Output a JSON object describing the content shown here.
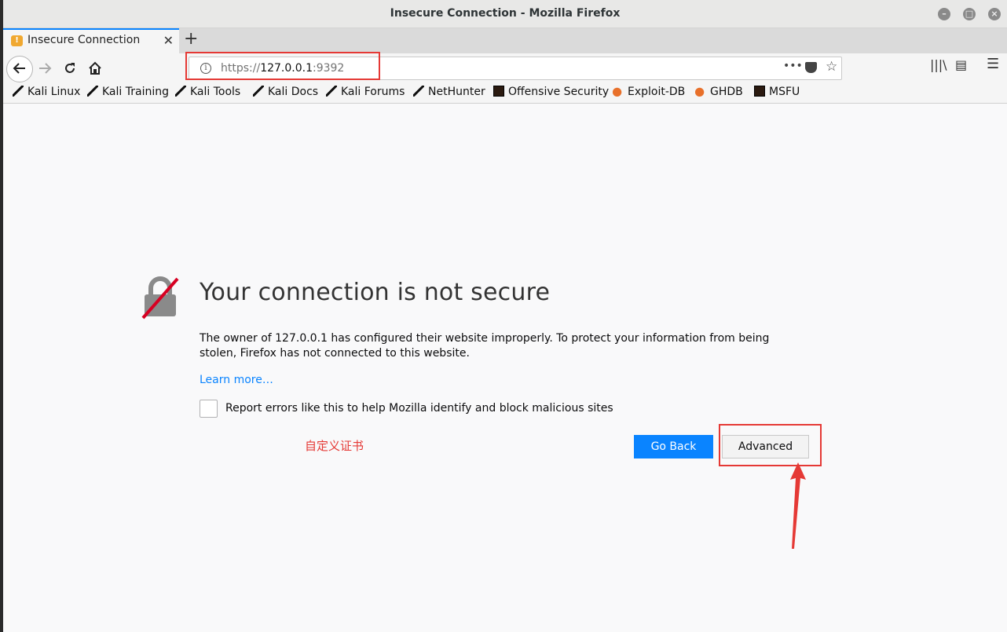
{
  "window": {
    "title": "Insecure Connection - Mozilla Firefox"
  },
  "tab": {
    "title": "Insecure Connection",
    "close": "✕",
    "new_tab": "+"
  },
  "urlbar": {
    "scheme": "https://",
    "host": "127.0.0.1",
    "port": ":9392",
    "page_actions": "•••"
  },
  "bookmarks": [
    {
      "label": "Kali Linux",
      "icon": "kali-dragon-icon"
    },
    {
      "label": "Kali Training",
      "icon": "kali-dragon-icon"
    },
    {
      "label": "Kali Tools",
      "icon": "kali-dragon-icon"
    },
    {
      "label": "Kali Docs",
      "icon": "kali-dragon-icon"
    },
    {
      "label": "Kali Forums",
      "icon": "kali-dragon-icon"
    },
    {
      "label": "NetHunter",
      "icon": "kali-dragon-icon"
    },
    {
      "label": "Offensive Security",
      "icon": "offsec-icon"
    },
    {
      "label": "Exploit-DB",
      "icon": "exploitdb-icon"
    },
    {
      "label": "GHDB",
      "icon": "exploitdb-icon"
    },
    {
      "label": "MSFU",
      "icon": "offsec-icon"
    }
  ],
  "error_page": {
    "headline": "Your connection is not secure",
    "description": "The owner of 127.0.0.1 has configured their website improperly. To protect your information from being stolen, Firefox has not connected to this website.",
    "learn_more": "Learn more…",
    "report_label": "Report errors like this to help Mozilla identify and block malicious sites",
    "go_back": "Go Back",
    "advanced": "Advanced"
  },
  "annotation": {
    "text": "自定义证书"
  },
  "colors": {
    "accent": "#0a84ff",
    "annotation_red": "#e53935"
  }
}
